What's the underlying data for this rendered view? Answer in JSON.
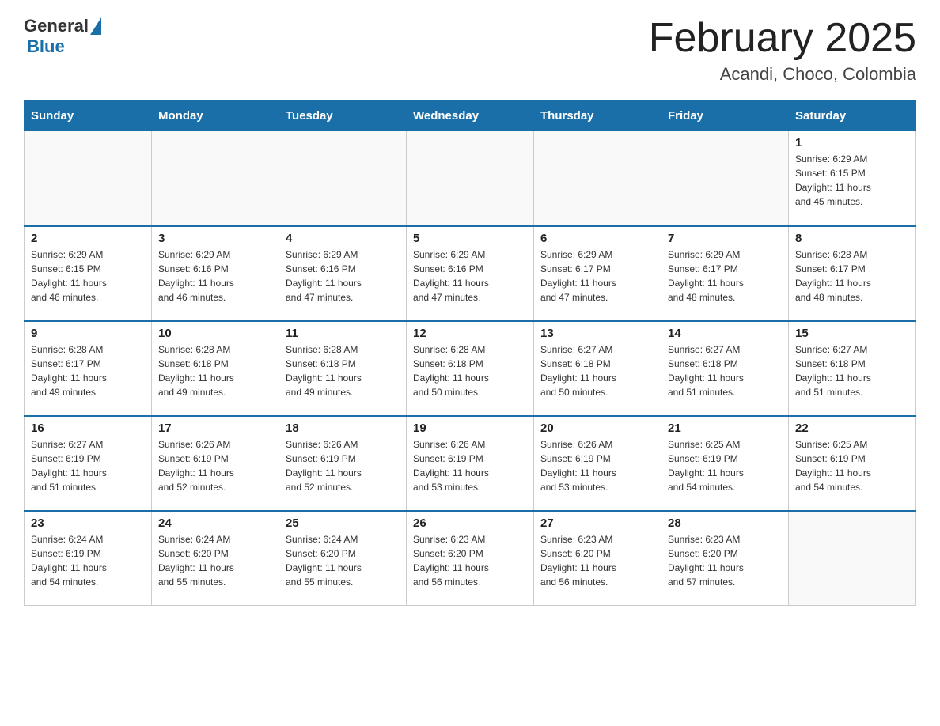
{
  "header": {
    "logo_general": "General",
    "logo_blue": "Blue",
    "month_title": "February 2025",
    "location": "Acandi, Choco, Colombia"
  },
  "weekdays": [
    "Sunday",
    "Monday",
    "Tuesday",
    "Wednesday",
    "Thursday",
    "Friday",
    "Saturday"
  ],
  "weeks": [
    [
      {
        "day": "",
        "info": ""
      },
      {
        "day": "",
        "info": ""
      },
      {
        "day": "",
        "info": ""
      },
      {
        "day": "",
        "info": ""
      },
      {
        "day": "",
        "info": ""
      },
      {
        "day": "",
        "info": ""
      },
      {
        "day": "1",
        "info": "Sunrise: 6:29 AM\nSunset: 6:15 PM\nDaylight: 11 hours\nand 45 minutes."
      }
    ],
    [
      {
        "day": "2",
        "info": "Sunrise: 6:29 AM\nSunset: 6:15 PM\nDaylight: 11 hours\nand 46 minutes."
      },
      {
        "day": "3",
        "info": "Sunrise: 6:29 AM\nSunset: 6:16 PM\nDaylight: 11 hours\nand 46 minutes."
      },
      {
        "day": "4",
        "info": "Sunrise: 6:29 AM\nSunset: 6:16 PM\nDaylight: 11 hours\nand 47 minutes."
      },
      {
        "day": "5",
        "info": "Sunrise: 6:29 AM\nSunset: 6:16 PM\nDaylight: 11 hours\nand 47 minutes."
      },
      {
        "day": "6",
        "info": "Sunrise: 6:29 AM\nSunset: 6:17 PM\nDaylight: 11 hours\nand 47 minutes."
      },
      {
        "day": "7",
        "info": "Sunrise: 6:29 AM\nSunset: 6:17 PM\nDaylight: 11 hours\nand 48 minutes."
      },
      {
        "day": "8",
        "info": "Sunrise: 6:28 AM\nSunset: 6:17 PM\nDaylight: 11 hours\nand 48 minutes."
      }
    ],
    [
      {
        "day": "9",
        "info": "Sunrise: 6:28 AM\nSunset: 6:17 PM\nDaylight: 11 hours\nand 49 minutes."
      },
      {
        "day": "10",
        "info": "Sunrise: 6:28 AM\nSunset: 6:18 PM\nDaylight: 11 hours\nand 49 minutes."
      },
      {
        "day": "11",
        "info": "Sunrise: 6:28 AM\nSunset: 6:18 PM\nDaylight: 11 hours\nand 49 minutes."
      },
      {
        "day": "12",
        "info": "Sunrise: 6:28 AM\nSunset: 6:18 PM\nDaylight: 11 hours\nand 50 minutes."
      },
      {
        "day": "13",
        "info": "Sunrise: 6:27 AM\nSunset: 6:18 PM\nDaylight: 11 hours\nand 50 minutes."
      },
      {
        "day": "14",
        "info": "Sunrise: 6:27 AM\nSunset: 6:18 PM\nDaylight: 11 hours\nand 51 minutes."
      },
      {
        "day": "15",
        "info": "Sunrise: 6:27 AM\nSunset: 6:18 PM\nDaylight: 11 hours\nand 51 minutes."
      }
    ],
    [
      {
        "day": "16",
        "info": "Sunrise: 6:27 AM\nSunset: 6:19 PM\nDaylight: 11 hours\nand 51 minutes."
      },
      {
        "day": "17",
        "info": "Sunrise: 6:26 AM\nSunset: 6:19 PM\nDaylight: 11 hours\nand 52 minutes."
      },
      {
        "day": "18",
        "info": "Sunrise: 6:26 AM\nSunset: 6:19 PM\nDaylight: 11 hours\nand 52 minutes."
      },
      {
        "day": "19",
        "info": "Sunrise: 6:26 AM\nSunset: 6:19 PM\nDaylight: 11 hours\nand 53 minutes."
      },
      {
        "day": "20",
        "info": "Sunrise: 6:26 AM\nSunset: 6:19 PM\nDaylight: 11 hours\nand 53 minutes."
      },
      {
        "day": "21",
        "info": "Sunrise: 6:25 AM\nSunset: 6:19 PM\nDaylight: 11 hours\nand 54 minutes."
      },
      {
        "day": "22",
        "info": "Sunrise: 6:25 AM\nSunset: 6:19 PM\nDaylight: 11 hours\nand 54 minutes."
      }
    ],
    [
      {
        "day": "23",
        "info": "Sunrise: 6:24 AM\nSunset: 6:19 PM\nDaylight: 11 hours\nand 54 minutes."
      },
      {
        "day": "24",
        "info": "Sunrise: 6:24 AM\nSunset: 6:20 PM\nDaylight: 11 hours\nand 55 minutes."
      },
      {
        "day": "25",
        "info": "Sunrise: 6:24 AM\nSunset: 6:20 PM\nDaylight: 11 hours\nand 55 minutes."
      },
      {
        "day": "26",
        "info": "Sunrise: 6:23 AM\nSunset: 6:20 PM\nDaylight: 11 hours\nand 56 minutes."
      },
      {
        "day": "27",
        "info": "Sunrise: 6:23 AM\nSunset: 6:20 PM\nDaylight: 11 hours\nand 56 minutes."
      },
      {
        "day": "28",
        "info": "Sunrise: 6:23 AM\nSunset: 6:20 PM\nDaylight: 11 hours\nand 57 minutes."
      },
      {
        "day": "",
        "info": ""
      }
    ]
  ]
}
